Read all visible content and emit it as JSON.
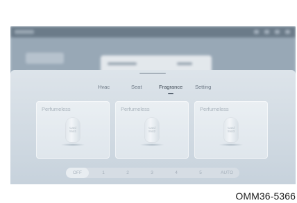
{
  "panel": {
    "tabs": [
      {
        "label": "Hvac"
      },
      {
        "label": "Seat"
      },
      {
        "label": "Fragrance"
      },
      {
        "label": "Setting"
      }
    ],
    "active_tab": "Fragrance",
    "cards": [
      {
        "title": "Perfumeless",
        "label_line1": "Card",
        "label_line2": "Slot1"
      },
      {
        "title": "Perfumeless",
        "label_line1": "Card",
        "label_line2": "Slot2"
      },
      {
        "title": "Perfumeless",
        "label_line1": "Card",
        "label_line2": "Slot3"
      }
    ],
    "levels": [
      "OFF",
      "1",
      "2",
      "3",
      "4",
      "5",
      "AUTO"
    ],
    "selected_level": "OFF"
  },
  "caption": "OMM36-5366",
  "colors": {
    "panel_bg": "#d7dfe6",
    "card_bg": "#e6ecf0",
    "text_muted": "#a9b3bc",
    "caption": "#1c1c1c"
  }
}
